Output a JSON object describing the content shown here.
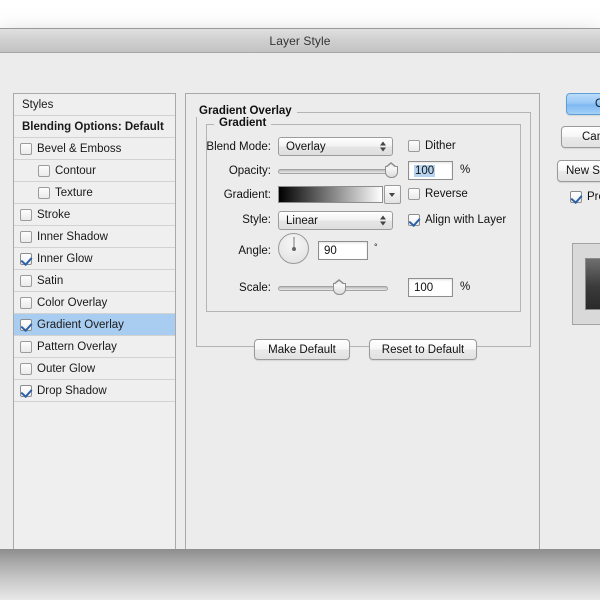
{
  "window": {
    "title": "Layer Style"
  },
  "sidebar": {
    "header": "Styles",
    "blending_options": "Blending Options: Default",
    "items": [
      {
        "label": "Bevel & Emboss",
        "checked": false,
        "indent": false,
        "selected": false
      },
      {
        "label": "Contour",
        "checked": false,
        "indent": true,
        "selected": false
      },
      {
        "label": "Texture",
        "checked": false,
        "indent": true,
        "selected": false
      },
      {
        "label": "Stroke",
        "checked": false,
        "indent": false,
        "selected": false
      },
      {
        "label": "Inner Shadow",
        "checked": false,
        "indent": false,
        "selected": false
      },
      {
        "label": "Inner Glow",
        "checked": true,
        "indent": false,
        "selected": false
      },
      {
        "label": "Satin",
        "checked": false,
        "indent": false,
        "selected": false
      },
      {
        "label": "Color Overlay",
        "checked": false,
        "indent": false,
        "selected": false
      },
      {
        "label": "Gradient Overlay",
        "checked": true,
        "indent": false,
        "selected": true
      },
      {
        "label": "Pattern Overlay",
        "checked": false,
        "indent": false,
        "selected": false
      },
      {
        "label": "Outer Glow",
        "checked": false,
        "indent": false,
        "selected": false
      },
      {
        "label": "Drop Shadow",
        "checked": true,
        "indent": false,
        "selected": false
      }
    ]
  },
  "main": {
    "section_title": "Gradient Overlay",
    "group_title": "Gradient",
    "blend_mode": {
      "label": "Blend Mode:",
      "value": "Overlay"
    },
    "opacity": {
      "label": "Opacity:",
      "value": "100",
      "unit": "%",
      "percent": 100
    },
    "gradient": {
      "label": "Gradient:",
      "from_color": "#000000",
      "to_color": "#ffffff"
    },
    "style": {
      "label": "Style:",
      "value": "Linear"
    },
    "angle": {
      "label": "Angle:",
      "value": "90",
      "unit": "°"
    },
    "scale": {
      "label": "Scale:",
      "value": "100",
      "unit": "%",
      "percent": 100
    },
    "dither": {
      "label": "Dither",
      "checked": false
    },
    "reverse": {
      "label": "Reverse",
      "checked": false
    },
    "align_with_layer": {
      "label": "Align with Layer",
      "checked": true
    },
    "make_default_label": "Make Default",
    "reset_default_label": "Reset to Default"
  },
  "right": {
    "ok_label": "OK",
    "cancel_label": "Cancel",
    "new_style_label": "New Style...",
    "preview_label": "Preview",
    "preview_checked": true
  },
  "colors": {
    "selection_blue": "#a9cdf0",
    "text_selection": "#b6d4f0",
    "dialog_bg": "#ececec",
    "panel_border": "#a9a9a9"
  }
}
